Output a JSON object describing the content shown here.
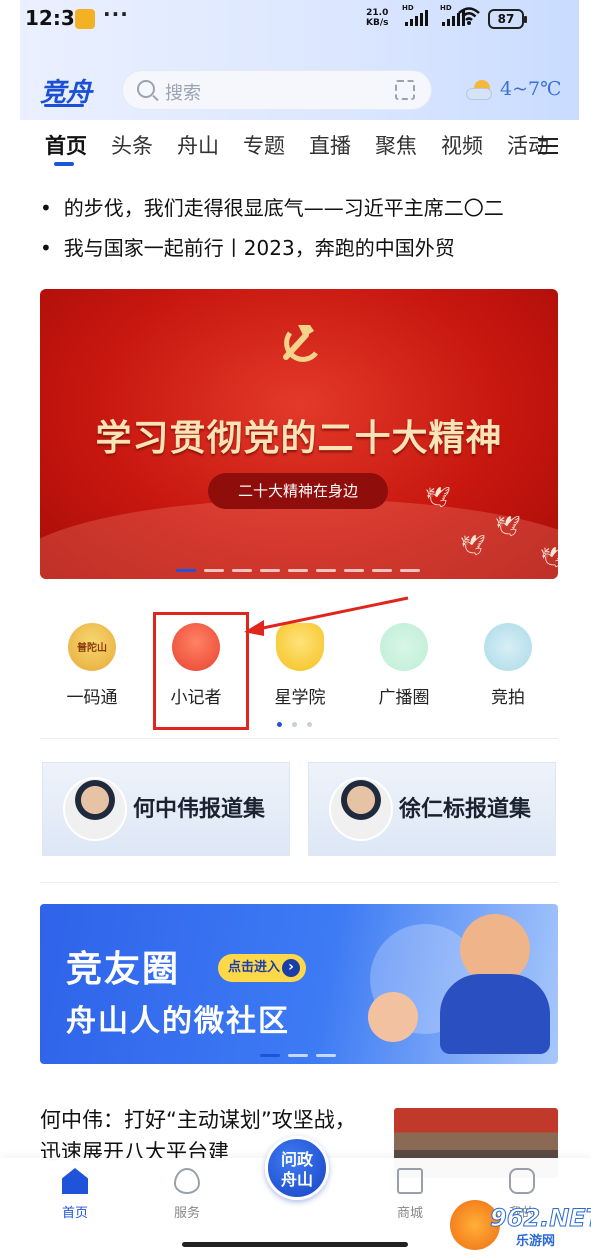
{
  "status_bar": {
    "time": "12:31",
    "dots": "···",
    "net_speed_value": "21.0",
    "net_speed_unit": "KB/s",
    "sim1_label": "HD",
    "sim2_label": "HD",
    "battery": "87"
  },
  "header": {
    "logo": "竞舟",
    "search_placeholder": "搜索",
    "weather": "4~7℃"
  },
  "tabs": [
    "首页",
    "头条",
    "舟山",
    "专题",
    "直播",
    "聚焦",
    "视频",
    "活动"
  ],
  "active_tab": 0,
  "headlines": [
    "的步伐，我们走得很显底气——习近平主席二〇二",
    "我与国家一起前行丨2023，奔跑的中国外贸"
  ],
  "banner": {
    "title": "学习贯彻党的二十大精神",
    "subtitle": "二十大精神在身边",
    "slide_count": 9,
    "active_slide": 0
  },
  "shortcuts": [
    {
      "label": "一码通",
      "icon": "putuoshan-icon",
      "icon_text": "普陀山"
    },
    {
      "label": "小记者",
      "icon": "reporter-icon"
    },
    {
      "label": "星学院",
      "icon": "star-mascot-icon"
    },
    {
      "label": "广播圈",
      "icon": "radio-icon"
    },
    {
      "label": "竞拍",
      "icon": "auction-icon"
    }
  ],
  "shortcut_pages": 3,
  "reports": [
    {
      "title": "何中伟报道集"
    },
    {
      "title": "徐仁标报道集"
    }
  ],
  "promo": {
    "title": "竞友圈",
    "button": "点击进入",
    "subtitle": "舟山人的微社区"
  },
  "news": {
    "title": "何中伟：打好“主动谋划”攻坚战，迅速展开八大平台建"
  },
  "bottom_nav": {
    "items": [
      {
        "label": "首页",
        "icon": "home-icon"
      },
      {
        "label": "服务",
        "icon": "heart-icon"
      },
      {
        "label": "商城",
        "icon": "bag-icon"
      },
      {
        "label": "我的",
        "icon": "chat-icon"
      }
    ],
    "center_label_1": "问政",
    "center_label_2": "舟山"
  },
  "watermark": {
    "text": "962.NET",
    "sub": "乐游网"
  },
  "colors": {
    "accent": "#1f53d9",
    "banner_red": "#c8170f",
    "highlight": "#e0251d"
  }
}
